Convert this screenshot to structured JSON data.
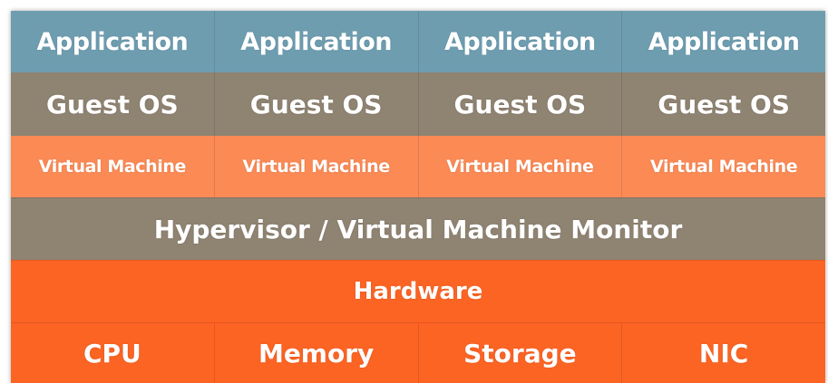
{
  "layers": {
    "application": [
      "Application",
      "Application",
      "Application",
      "Application"
    ],
    "guest_os": [
      "Guest OS",
      "Guest OS",
      "Guest OS",
      "Guest OS"
    ],
    "virtual_machine": [
      "Virtual Machine",
      "Virtual Machine",
      "Virtual Machine",
      "Virtual Machine"
    ],
    "hypervisor": "Hypervisor / Virtual Machine Monitor",
    "hardware": "Hardware",
    "components": [
      "CPU",
      "Memory",
      "Storage",
      "NIC"
    ]
  },
  "colors": {
    "application": "#6e9db0",
    "guest_os": "#8f8372",
    "virtual_machine": "#fb8a55",
    "hypervisor": "#8f8372",
    "hardware": "#fc6424",
    "text": "#ffffff"
  }
}
